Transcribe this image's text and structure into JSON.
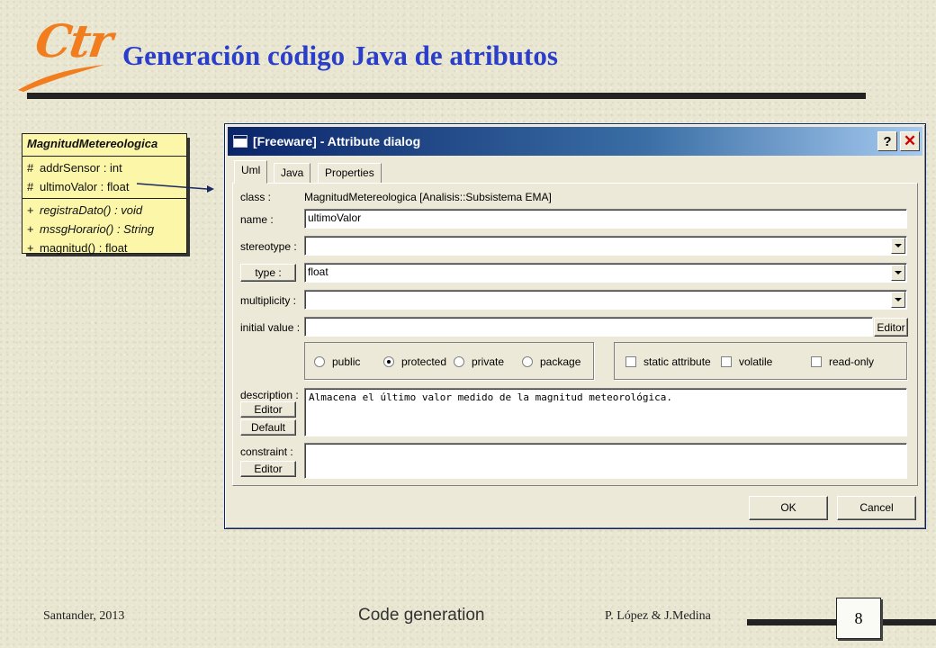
{
  "slide": {
    "logo_text": "Ctr",
    "title": "Generación código Java de atributos",
    "footer_left": "Santander, 2013",
    "footer_center": "Code generation",
    "footer_right": "P. López & J.Medina",
    "page_number": "8"
  },
  "uml_class": {
    "name": "MagnitudMetereologica",
    "attributes": [
      {
        "visibility": "#",
        "text": "addrSensor : int"
      },
      {
        "visibility": "#",
        "text": "ultimoValor : float"
      }
    ],
    "operations": [
      {
        "visibility": "+",
        "text": "registraDato() : void"
      },
      {
        "visibility": "+",
        "text": "mssgHorario() : String"
      },
      {
        "visibility": "+",
        "text": "magnitud() : float"
      }
    ]
  },
  "dialog": {
    "title": "[Freeware] - Attribute dialog",
    "help_button": "?",
    "close_button": "✕",
    "tabs": [
      {
        "label": "Uml",
        "active": true
      },
      {
        "label": "Java",
        "active": false
      },
      {
        "label": "Properties",
        "active": false
      }
    ],
    "form": {
      "class_label": "class :",
      "class_value": "MagnitudMetereologica   [Analisis::Subsistema EMA]",
      "name_label": "name :",
      "name_value": "ultimoValor",
      "stereotype_label": "stereotype :",
      "stereotype_value": "",
      "type_button": "type :",
      "type_value": "float",
      "multiplicity_label": "multiplicity :",
      "multiplicity_value": "",
      "initial_value_label": "initial value :",
      "initial_value_value": "",
      "initial_editor_button": "Editor",
      "visibility_options": [
        {
          "label": "public",
          "checked": false
        },
        {
          "label": "protected",
          "checked": true
        },
        {
          "label": "private",
          "checked": false
        },
        {
          "label": "package",
          "checked": false
        }
      ],
      "flags": [
        {
          "label": "static attribute",
          "checked": false
        },
        {
          "label": "volatile",
          "checked": false
        },
        {
          "label": "read-only",
          "checked": false
        }
      ],
      "description_label": "description :",
      "description_editor_button": "Editor",
      "description_default_button": "Default",
      "description_value": "Almacena el último valor medido de la magnitud meteorológica.",
      "constraint_label": "constraint :",
      "constraint_editor_button": "Editor",
      "constraint_value": ""
    },
    "ok_button": "OK",
    "cancel_button": "Cancel"
  },
  "colors": {
    "slide_title": "#2a3ec9",
    "logo": "#f27d1f",
    "uml_fill": "#fbf6a8",
    "titlebar_start": "#0a246a",
    "titlebar_end": "#a6caf0"
  }
}
